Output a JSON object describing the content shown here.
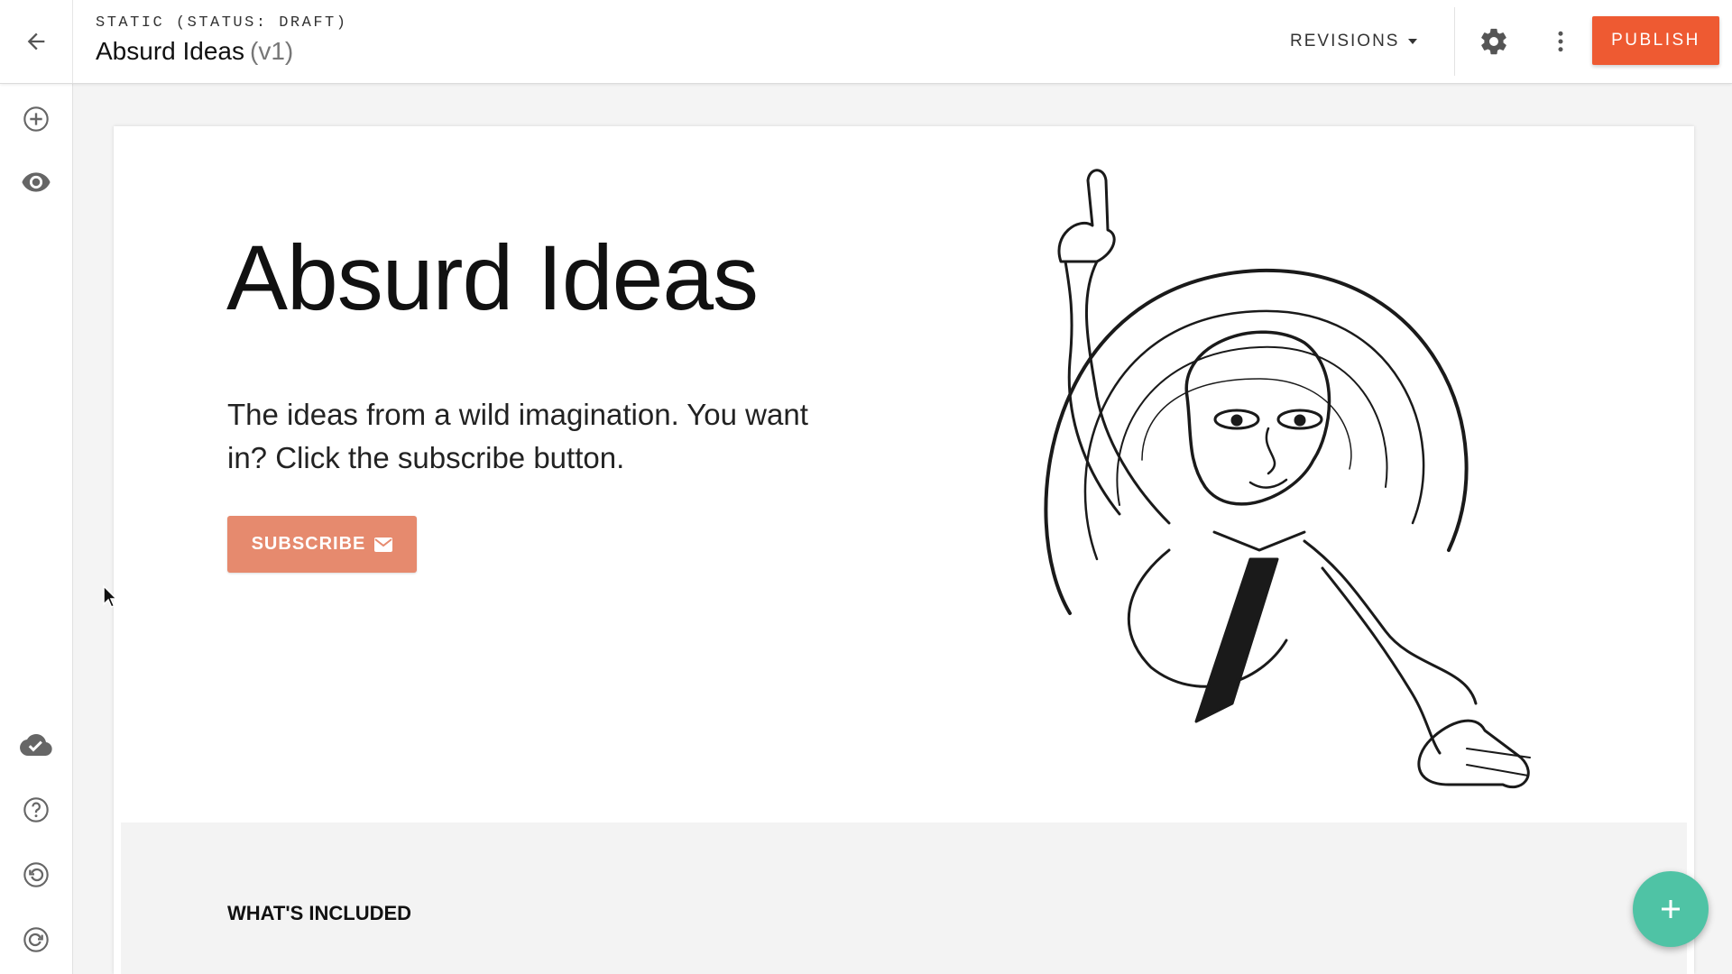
{
  "header": {
    "status_line": "STATIC (STATUS: DRAFT)",
    "page_title": "Absurd Ideas",
    "page_version": "(v1)",
    "revisions_label": "REVISIONS",
    "publish_label": "PUBLISH",
    "accent_color": "#ee5a32"
  },
  "sidebar": {
    "top_icons": [
      "add-circle-icon",
      "eye-icon"
    ],
    "bottom_icons": [
      "cloud-check-icon",
      "help-circle-icon",
      "undo-icon",
      "redo-icon"
    ]
  },
  "hero": {
    "title": "Absurd Ideas",
    "text": "The ideas from a wild imagination. You want in? Click the subscribe button.",
    "subscribe_label": "SUBSCRIBE",
    "subscribe_color": "#e68a6e"
  },
  "included": {
    "title": "WHAT'S INCLUDED"
  },
  "fab": {
    "icon": "plus-icon",
    "color": "#4fc3a5"
  }
}
